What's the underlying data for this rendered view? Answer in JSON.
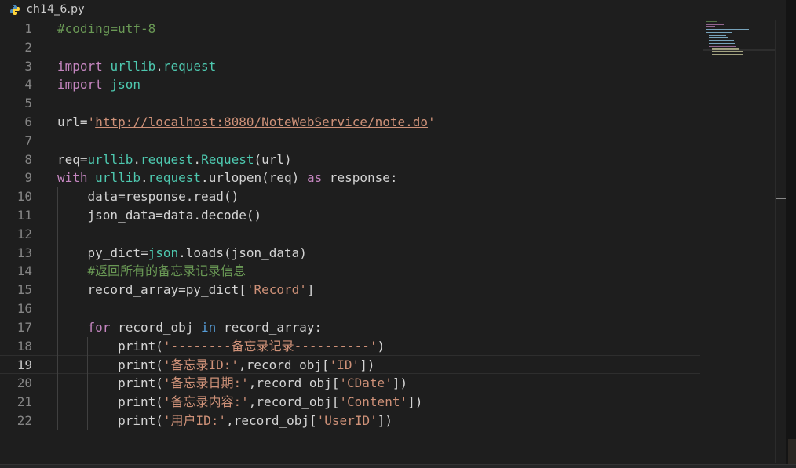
{
  "file_title": "ch14_6.py",
  "file_icon": "python-icon",
  "colors": {
    "comment": "#6a9955",
    "keyword": "#c586c0",
    "flow": "#569cd6",
    "variable": "#9cdcfe",
    "string": "#ce9178",
    "function": "#dcdcaa",
    "class": "#4ec9b0",
    "plain": "#d4d4d4",
    "background": "#1e1e1e"
  },
  "active_line": 19,
  "lines": [
    {
      "n": "1",
      "tokens": [
        {
          "t": "#coding=utf-8",
          "c": "comment"
        }
      ]
    },
    {
      "n": "2",
      "tokens": []
    },
    {
      "n": "3",
      "tokens": [
        {
          "t": "import",
          "c": "keyword"
        },
        {
          "t": " ",
          "c": "plain"
        },
        {
          "t": "urllib",
          "c": "class"
        },
        {
          "t": ".",
          "c": "plain"
        },
        {
          "t": "request",
          "c": "class"
        }
      ]
    },
    {
      "n": "4",
      "tokens": [
        {
          "t": "import",
          "c": "keyword"
        },
        {
          "t": " ",
          "c": "plain"
        },
        {
          "t": "json",
          "c": "class"
        }
      ]
    },
    {
      "n": "5",
      "tokens": []
    },
    {
      "n": "6",
      "tokens": [
        {
          "t": "url",
          "c": "variable"
        },
        {
          "t": "=",
          "c": "plain"
        },
        {
          "t": "'",
          "c": "string"
        },
        {
          "t": "http://localhost:8080/NoteWebService/note.do",
          "c": "url"
        },
        {
          "t": "'",
          "c": "string"
        }
      ]
    },
    {
      "n": "7",
      "tokens": []
    },
    {
      "n": "8",
      "tokens": [
        {
          "t": "req",
          "c": "variable"
        },
        {
          "t": "=",
          "c": "plain"
        },
        {
          "t": "urllib",
          "c": "class"
        },
        {
          "t": ".",
          "c": "plain"
        },
        {
          "t": "request",
          "c": "class"
        },
        {
          "t": ".",
          "c": "plain"
        },
        {
          "t": "Request",
          "c": "class"
        },
        {
          "t": "(",
          "c": "plain"
        },
        {
          "t": "url",
          "c": "variable"
        },
        {
          "t": ")",
          "c": "plain"
        }
      ]
    },
    {
      "n": "9",
      "tokens": [
        {
          "t": "with",
          "c": "keyword"
        },
        {
          "t": " ",
          "c": "plain"
        },
        {
          "t": "urllib",
          "c": "class"
        },
        {
          "t": ".",
          "c": "plain"
        },
        {
          "t": "request",
          "c": "class"
        },
        {
          "t": ".",
          "c": "plain"
        },
        {
          "t": "urlopen",
          "c": "function"
        },
        {
          "t": "(",
          "c": "plain"
        },
        {
          "t": "req",
          "c": "variable"
        },
        {
          "t": ") ",
          "c": "plain"
        },
        {
          "t": "as",
          "c": "keyword"
        },
        {
          "t": " ",
          "c": "plain"
        },
        {
          "t": "response",
          "c": "variable"
        },
        {
          "t": ":",
          "c": "plain"
        }
      ]
    },
    {
      "n": "10",
      "tokens": [
        {
          "t": "    ",
          "c": "plain"
        },
        {
          "t": "data",
          "c": "variable"
        },
        {
          "t": "=",
          "c": "plain"
        },
        {
          "t": "response",
          "c": "variable"
        },
        {
          "t": ".",
          "c": "plain"
        },
        {
          "t": "read",
          "c": "function"
        },
        {
          "t": "()",
          "c": "plain"
        }
      ]
    },
    {
      "n": "11",
      "tokens": [
        {
          "t": "    ",
          "c": "plain"
        },
        {
          "t": "json_data",
          "c": "variable"
        },
        {
          "t": "=",
          "c": "plain"
        },
        {
          "t": "data",
          "c": "variable"
        },
        {
          "t": ".",
          "c": "plain"
        },
        {
          "t": "decode",
          "c": "function"
        },
        {
          "t": "()",
          "c": "plain"
        }
      ]
    },
    {
      "n": "12",
      "tokens": []
    },
    {
      "n": "13",
      "tokens": [
        {
          "t": "    ",
          "c": "plain"
        },
        {
          "t": "py_dict",
          "c": "variable"
        },
        {
          "t": "=",
          "c": "plain"
        },
        {
          "t": "json",
          "c": "class"
        },
        {
          "t": ".",
          "c": "plain"
        },
        {
          "t": "loads",
          "c": "function"
        },
        {
          "t": "(",
          "c": "plain"
        },
        {
          "t": "json_data",
          "c": "variable"
        },
        {
          "t": ")",
          "c": "plain"
        }
      ]
    },
    {
      "n": "14",
      "tokens": [
        {
          "t": "    ",
          "c": "plain"
        },
        {
          "t": "#返回所有的备忘录记录信息",
          "c": "comment"
        }
      ]
    },
    {
      "n": "15",
      "tokens": [
        {
          "t": "    ",
          "c": "plain"
        },
        {
          "t": "record_array",
          "c": "variable"
        },
        {
          "t": "=",
          "c": "plain"
        },
        {
          "t": "py_dict",
          "c": "variable"
        },
        {
          "t": "[",
          "c": "plain"
        },
        {
          "t": "'Record'",
          "c": "string"
        },
        {
          "t": "]",
          "c": "plain"
        }
      ]
    },
    {
      "n": "16",
      "tokens": []
    },
    {
      "n": "17",
      "tokens": [
        {
          "t": "    ",
          "c": "plain"
        },
        {
          "t": "for",
          "c": "keyword"
        },
        {
          "t": " ",
          "c": "plain"
        },
        {
          "t": "record_obj",
          "c": "variable"
        },
        {
          "t": " ",
          "c": "plain"
        },
        {
          "t": "in",
          "c": "flow"
        },
        {
          "t": " ",
          "c": "plain"
        },
        {
          "t": "record_array",
          "c": "variable"
        },
        {
          "t": ":",
          "c": "plain"
        }
      ]
    },
    {
      "n": "18",
      "tokens": [
        {
          "t": "        ",
          "c": "plain"
        },
        {
          "t": "print",
          "c": "function"
        },
        {
          "t": "(",
          "c": "plain"
        },
        {
          "t": "'--------备忘录记录----------'",
          "c": "string"
        },
        {
          "t": ")",
          "c": "plain"
        }
      ]
    },
    {
      "n": "19",
      "tokens": [
        {
          "t": "        ",
          "c": "plain"
        },
        {
          "t": "print",
          "c": "function"
        },
        {
          "t": "(",
          "c": "plain"
        },
        {
          "t": "'备忘录ID:'",
          "c": "string"
        },
        {
          "t": ",",
          "c": "plain"
        },
        {
          "t": "record_obj",
          "c": "variable"
        },
        {
          "t": "[",
          "c": "plain"
        },
        {
          "t": "'ID'",
          "c": "string"
        },
        {
          "t": "])",
          "c": "plain"
        }
      ]
    },
    {
      "n": "20",
      "tokens": [
        {
          "t": "        ",
          "c": "plain"
        },
        {
          "t": "print",
          "c": "function"
        },
        {
          "t": "(",
          "c": "plain"
        },
        {
          "t": "'备忘录日期:'",
          "c": "string"
        },
        {
          "t": ",",
          "c": "plain"
        },
        {
          "t": "record_obj",
          "c": "variable"
        },
        {
          "t": "[",
          "c": "plain"
        },
        {
          "t": "'CDate'",
          "c": "string"
        },
        {
          "t": "])",
          "c": "plain"
        }
      ]
    },
    {
      "n": "21",
      "tokens": [
        {
          "t": "        ",
          "c": "plain"
        },
        {
          "t": "print",
          "c": "function"
        },
        {
          "t": "(",
          "c": "plain"
        },
        {
          "t": "'备忘录内容:'",
          "c": "string"
        },
        {
          "t": ",",
          "c": "plain"
        },
        {
          "t": "record_obj",
          "c": "variable"
        },
        {
          "t": "[",
          "c": "plain"
        },
        {
          "t": "'Content'",
          "c": "string"
        },
        {
          "t": "])",
          "c": "plain"
        }
      ]
    },
    {
      "n": "22",
      "tokens": [
        {
          "t": "        ",
          "c": "plain"
        },
        {
          "t": "print",
          "c": "function"
        },
        {
          "t": "(",
          "c": "plain"
        },
        {
          "t": "'用户ID:'",
          "c": "string"
        },
        {
          "t": ",",
          "c": "plain"
        },
        {
          "t": "record_obj",
          "c": "variable"
        },
        {
          "t": "[",
          "c": "plain"
        },
        {
          "t": "'UserID'",
          "c": "string"
        },
        {
          "t": "])",
          "c": "plain"
        }
      ]
    }
  ]
}
